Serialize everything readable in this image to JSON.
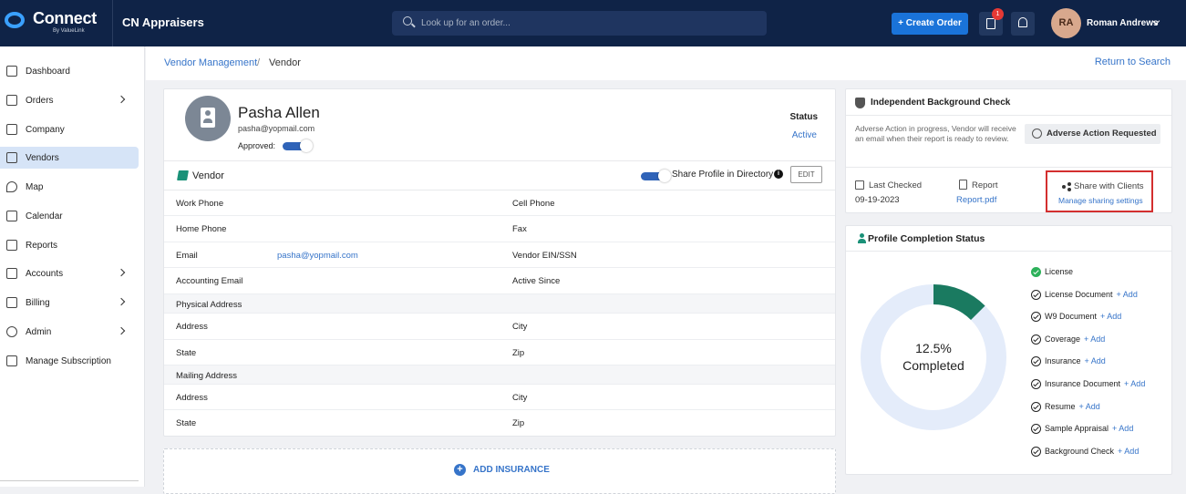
{
  "header": {
    "logo_text": "Connect",
    "logo_sub": "By ValueLink",
    "app_title": "CN Appraisers",
    "search_placeholder": "Look up for an order...",
    "create_order_label": "+ Create Order",
    "notification_count": "1",
    "avatar_initials": "RA",
    "user_name": "Roman Andrews"
  },
  "sidebar": {
    "items": [
      {
        "label": "Dashboard",
        "icon": "home-icon"
      },
      {
        "label": "Orders",
        "icon": "list-icon"
      },
      {
        "label": "Company",
        "icon": "building-icon"
      },
      {
        "label": "Vendors",
        "icon": "vendor-icon"
      },
      {
        "label": "Map",
        "icon": "map-pin-icon"
      },
      {
        "label": "Calendar",
        "icon": "calendar-icon"
      },
      {
        "label": "Reports",
        "icon": "reports-icon"
      },
      {
        "label": "Accounts",
        "icon": "bank-icon"
      },
      {
        "label": "Billing",
        "icon": "billing-icon"
      },
      {
        "label": "Admin",
        "icon": "admin-icon"
      },
      {
        "label": "Manage Subscription",
        "icon": "subscription-icon"
      }
    ]
  },
  "breadcrumb": {
    "parent": "Vendor Management",
    "separator": "/",
    "current": "Vendor",
    "return_link": "Return to Search"
  },
  "profile": {
    "name": "Pasha Allen",
    "email": "pasha@yopmail.com",
    "approved_label": "Approved:",
    "approved": true,
    "status_label": "Status",
    "status_value": "Active"
  },
  "vendor_section": {
    "title": "Vendor",
    "share_label": "Share Profile in Directory",
    "share_enabled": true,
    "edit_label": "EDIT",
    "rows": [
      {
        "left_label": "Work Phone",
        "left_value": "",
        "right_label": "Cell Phone",
        "right_value": ""
      },
      {
        "left_label": "Home Phone",
        "left_value": "",
        "right_label": "Fax",
        "right_value": ""
      },
      {
        "left_label": "Email",
        "left_value": "pasha@yopmail.com",
        "right_label": "Vendor EIN/SSN",
        "right_value": ""
      },
      {
        "left_label": "Accounting Email",
        "left_value": "",
        "right_label": "Active Since",
        "right_value": ""
      }
    ],
    "physical_address_label": "Physical Address",
    "physical_rows": [
      {
        "left_label": "Address",
        "right_label": "City"
      },
      {
        "left_label": "State",
        "right_label": "Zip"
      }
    ],
    "mailing_address_label": "Mailing Address",
    "mailing_rows": [
      {
        "left_label": "Address",
        "right_label": "City"
      },
      {
        "left_label": "State",
        "right_label": "Zip"
      }
    ]
  },
  "insurance": {
    "add_label": "ADD INSURANCE"
  },
  "background_check": {
    "title": "Independent Background Check",
    "note": "Adverse Action in progress, Vendor will receive an email when their report is ready to review.",
    "adverse_button": "Adverse Action Requested",
    "last_checked_label": "Last Checked",
    "last_checked_date": "09-19-2023",
    "report_label": "Report",
    "report_file": "Report.pdf",
    "share_label": "Share with Clients",
    "manage_link": "Manage sharing settings"
  },
  "profile_completion": {
    "title": "Profile Completion Status",
    "percent_label": "12.5%",
    "completed_label": "Completed",
    "percent_value": 12.5,
    "colors": {
      "filled": "#1a7a60",
      "remaining": "#e4ecfa"
    },
    "add_label": "+ Add",
    "items": [
      {
        "label": "License",
        "done": true
      },
      {
        "label": "License Document",
        "done": false
      },
      {
        "label": "W9 Document",
        "done": false
      },
      {
        "label": "Coverage",
        "done": false
      },
      {
        "label": "Insurance",
        "done": false
      },
      {
        "label": "Insurance Document",
        "done": false
      },
      {
        "label": "Resume",
        "done": false
      },
      {
        "label": "Sample Appraisal",
        "done": false
      },
      {
        "label": "Background Check",
        "done": false
      }
    ]
  }
}
